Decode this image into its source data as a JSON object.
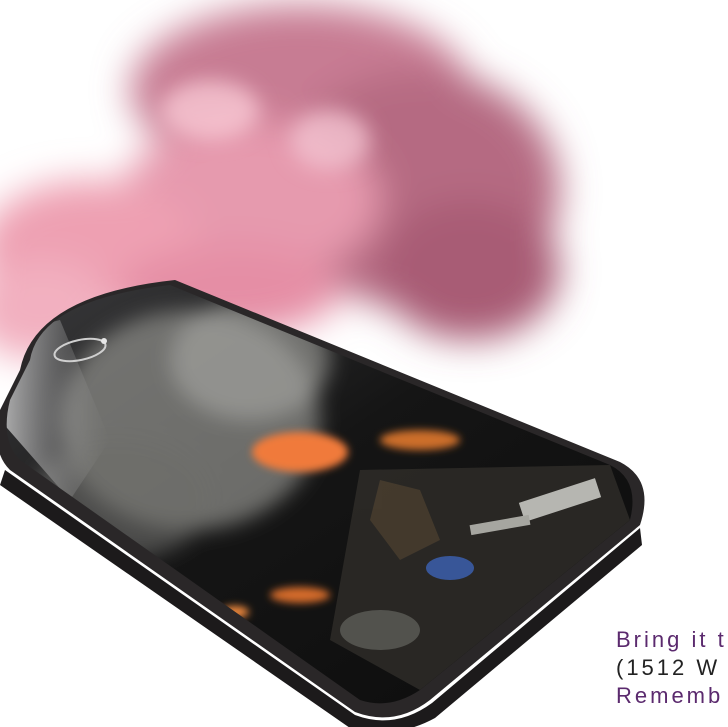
{
  "caption": {
    "line1": "Bring it t",
    "line2": "(1512 W",
    "line3": "Rememb"
  },
  "colors": {
    "background": "#ffffff",
    "smoke_pink": "#d98aa0",
    "phone_body": "#2a2728",
    "fire": "#f07a3a",
    "caption_purple": "#5b2a6e"
  }
}
